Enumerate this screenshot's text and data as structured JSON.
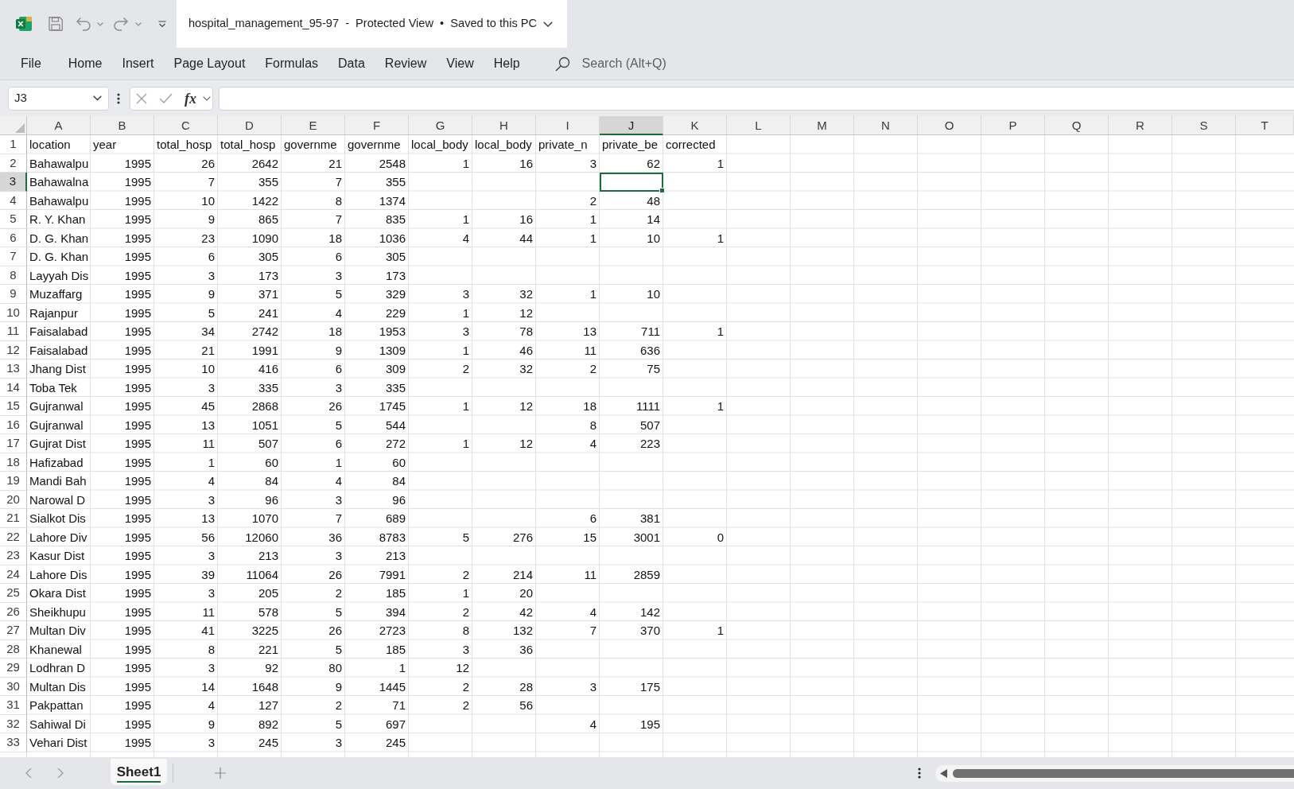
{
  "window": {
    "title": "hospital_management_95-97  -  Protected View  •  Saved to this PC"
  },
  "menu": [
    "File",
    "Home",
    "Insert",
    "Page Layout",
    "Formulas",
    "Data",
    "Review",
    "View",
    "Help"
  ],
  "search": {
    "placeholder": "Search (Alt+Q)"
  },
  "formula_bar": {
    "name_box": "J3",
    "function_button": "fx"
  },
  "sheet": {
    "columns": [
      {
        "label": "A",
        "selected": false,
        "kind": "text"
      },
      {
        "label": "B",
        "selected": false,
        "kind": "number"
      },
      {
        "label": "C",
        "selected": false,
        "kind": "number"
      },
      {
        "label": "D",
        "selected": false,
        "kind": "number"
      },
      {
        "label": "E",
        "selected": false,
        "kind": "number"
      },
      {
        "label": "F",
        "selected": false,
        "kind": "number"
      },
      {
        "label": "G",
        "selected": false,
        "kind": "number"
      },
      {
        "label": "H",
        "selected": false,
        "kind": "number"
      },
      {
        "label": "I",
        "selected": false,
        "kind": "number"
      },
      {
        "label": "J",
        "selected": true,
        "kind": "number"
      },
      {
        "label": "K",
        "selected": false,
        "kind": "number"
      },
      {
        "label": "L",
        "selected": false
      },
      {
        "label": "M",
        "selected": false
      },
      {
        "label": "N",
        "selected": false
      },
      {
        "label": "O",
        "selected": false
      },
      {
        "label": "P",
        "selected": false
      },
      {
        "label": "Q",
        "selected": false
      },
      {
        "label": "R",
        "selected": false
      },
      {
        "label": "S",
        "selected": false
      },
      {
        "label": "T",
        "selected": false
      }
    ],
    "rows": [
      {
        "label": "1",
        "selected": false,
        "kind": "heading",
        "cells": [
          "location",
          "year",
          "total_hosp",
          "total_hosp",
          "governme",
          "governme",
          "local_body",
          "local_body",
          "private_n",
          "private_be",
          "corrected"
        ]
      },
      {
        "label": "2",
        "selected": false,
        "kind": "record",
        "cells": [
          "Bahawalpu",
          "1995",
          "26",
          "2642",
          "21",
          "2548",
          "1",
          "16",
          "3",
          "62",
          "1"
        ]
      },
      {
        "label": "3",
        "selected": true,
        "kind": "record",
        "cells": [
          "Bahawalna",
          "1995",
          "7",
          "355",
          "7",
          "355"
        ]
      },
      {
        "label": "4",
        "selected": false,
        "kind": "record",
        "cells": [
          "Bahawalpu",
          "1995",
          "10",
          "1422",
          "8",
          "1374",
          null,
          null,
          "2",
          "48"
        ]
      },
      {
        "label": "5",
        "selected": false,
        "kind": "record",
        "cells": [
          "R. Y. Khan",
          "1995",
          "9",
          "865",
          "7",
          "835",
          "1",
          "16",
          "1",
          "14"
        ]
      },
      {
        "label": "6",
        "selected": false,
        "kind": "record",
        "cells": [
          "D. G. Khan",
          "1995",
          "23",
          "1090",
          "18",
          "1036",
          "4",
          "44",
          "1",
          "10",
          "1"
        ]
      },
      {
        "label": "7",
        "selected": false,
        "kind": "record",
        "cells": [
          "D. G. Khan",
          "1995",
          "6",
          "305",
          "6",
          "305"
        ]
      },
      {
        "label": "8",
        "selected": false,
        "kind": "record",
        "cells": [
          "Layyah Dis",
          "1995",
          "3",
          "173",
          "3",
          "173"
        ]
      },
      {
        "label": "9",
        "selected": false,
        "kind": "record",
        "cells": [
          "Muzaffarg",
          "1995",
          "9",
          "371",
          "5",
          "329",
          "3",
          "32",
          "1",
          "10"
        ]
      },
      {
        "label": "10",
        "selected": false,
        "kind": "record",
        "cells": [
          "Rajanpur",
          "1995",
          "5",
          "241",
          "4",
          "229",
          "1",
          "12"
        ]
      },
      {
        "label": "11",
        "selected": false,
        "kind": "record",
        "cells": [
          "Faisalabad",
          "1995",
          "34",
          "2742",
          "18",
          "1953",
          "3",
          "78",
          "13",
          "711",
          "1"
        ]
      },
      {
        "label": "12",
        "selected": false,
        "kind": "record",
        "cells": [
          "Faisalabad",
          "1995",
          "21",
          "1991",
          "9",
          "1309",
          "1",
          "46",
          "11",
          "636"
        ]
      },
      {
        "label": "13",
        "selected": false,
        "kind": "record",
        "cells": [
          "Jhang Dist",
          "1995",
          "10",
          "416",
          "6",
          "309",
          "2",
          "32",
          "2",
          "75"
        ]
      },
      {
        "label": "14",
        "selected": false,
        "kind": "record",
        "cells": [
          "Toba Tek",
          "1995",
          "3",
          "335",
          "3",
          "335"
        ]
      },
      {
        "label": "15",
        "selected": false,
        "kind": "record",
        "cells": [
          "Gujranwal",
          "1995",
          "45",
          "2868",
          "26",
          "1745",
          "1",
          "12",
          "18",
          "1111",
          "1"
        ]
      },
      {
        "label": "16",
        "selected": false,
        "kind": "record",
        "cells": [
          "Gujranwal",
          "1995",
          "13",
          "1051",
          "5",
          "544",
          null,
          null,
          "8",
          "507"
        ]
      },
      {
        "label": "17",
        "selected": false,
        "kind": "record",
        "cells": [
          "Gujrat Dist",
          "1995",
          "11",
          "507",
          "6",
          "272",
          "1",
          "12",
          "4",
          "223"
        ]
      },
      {
        "label": "18",
        "selected": false,
        "kind": "record",
        "cells": [
          "Hafizabad",
          "1995",
          "1",
          "60",
          "1",
          "60"
        ]
      },
      {
        "label": "19",
        "selected": false,
        "kind": "record",
        "cells": [
          "Mandi Bah",
          "1995",
          "4",
          "84",
          "4",
          "84"
        ]
      },
      {
        "label": "20",
        "selected": false,
        "kind": "record",
        "cells": [
          "Narowal D",
          "1995",
          "3",
          "96",
          "3",
          "96"
        ]
      },
      {
        "label": "21",
        "selected": false,
        "kind": "record",
        "cells": [
          "Sialkot Dis",
          "1995",
          "13",
          "1070",
          "7",
          "689",
          null,
          null,
          "6",
          "381"
        ]
      },
      {
        "label": "22",
        "selected": false,
        "kind": "record",
        "cells": [
          "Lahore Div",
          "1995",
          "56",
          "12060",
          "36",
          "8783",
          "5",
          "276",
          "15",
          "3001",
          "0"
        ]
      },
      {
        "label": "23",
        "selected": false,
        "kind": "record",
        "cells": [
          "Kasur Dist",
          "1995",
          "3",
          "213",
          "3",
          "213"
        ]
      },
      {
        "label": "24",
        "selected": false,
        "kind": "record",
        "cells": [
          "Lahore Dis",
          "1995",
          "39",
          "11064",
          "26",
          "7991",
          "2",
          "214",
          "11",
          "2859"
        ]
      },
      {
        "label": "25",
        "selected": false,
        "kind": "record",
        "cells": [
          "Okara Dist",
          "1995",
          "3",
          "205",
          "2",
          "185",
          "1",
          "20"
        ]
      },
      {
        "label": "26",
        "selected": false,
        "kind": "record",
        "cells": [
          "Sheikhupu",
          "1995",
          "11",
          "578",
          "5",
          "394",
          "2",
          "42",
          "4",
          "142"
        ]
      },
      {
        "label": "27",
        "selected": false,
        "kind": "record",
        "cells": [
          "Multan Div",
          "1995",
          "41",
          "3225",
          "26",
          "2723",
          "8",
          "132",
          "7",
          "370",
          "1"
        ]
      },
      {
        "label": "28",
        "selected": false,
        "kind": "record",
        "cells": [
          "Khanewal",
          "1995",
          "8",
          "221",
          "5",
          "185",
          "3",
          "36"
        ]
      },
      {
        "label": "29",
        "selected": false,
        "kind": "record",
        "cells": [
          "Lodhran D",
          "1995",
          "3",
          "92",
          "80",
          "1",
          "12"
        ]
      },
      {
        "label": "30",
        "selected": false,
        "kind": "record",
        "cells": [
          "Multan Dis",
          "1995",
          "14",
          "1648",
          "9",
          "1445",
          "2",
          "28",
          "3",
          "175"
        ]
      },
      {
        "label": "31",
        "selected": false,
        "kind": "record",
        "cells": [
          "Pakpattan",
          "1995",
          "4",
          "127",
          "2",
          "71",
          "2",
          "56"
        ]
      },
      {
        "label": "32",
        "selected": false,
        "kind": "record",
        "cells": [
          "Sahiwal Di",
          "1995",
          "9",
          "892",
          "5",
          "697",
          null,
          null,
          "4",
          "195"
        ]
      },
      {
        "label": "33",
        "selected": false,
        "kind": "record",
        "cells": [
          "Vehari Dist",
          "1995",
          "3",
          "245",
          "3",
          "245"
        ]
      }
    ]
  },
  "sheet_tabs": [
    {
      "label": "Sheet1",
      "selected": true
    }
  ]
}
